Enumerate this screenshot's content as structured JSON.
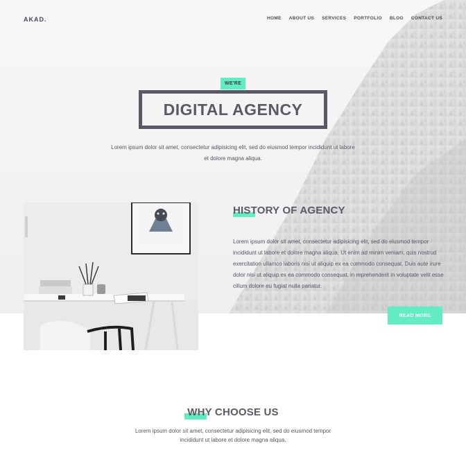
{
  "header": {
    "logo": "AKAD.",
    "nav": [
      "HOME",
      "ABOUT US",
      "SERVICES",
      "PORTFOLIO",
      "BLOG",
      "CONTACT US"
    ]
  },
  "hero": {
    "tag": "WE'RE",
    "title": "DIGITAL AGENCY",
    "text": "Lorem ipsum dolor sit amet, consectetur adipisicing elit, sed do eiusmod tempor incididunt ut labore et dolore magna aliqua."
  },
  "history": {
    "title": "HISTORY OF AGENCY",
    "text": "Lorem ipsum dolor sit amet, consectetur adipisicing elit, sed do eiusmod tempor incididunt ut labore et dolore magna aliqua. Ut enim ad minim veniam, quis nostrud exercitation ullamco laboris nisi ut aliquip ex ea commodo consequat. Duis aute irure dolor nisi ut aliquip ex ea commodo consequat. in reprehenderit in voluptate velit esse cillum dolore eu fugiat nulla pariatur.",
    "button": "READ MORE"
  },
  "why": {
    "title": "WHY CHOOSE US",
    "text": "Lorem ipsum dolor sit amet, consectetur adipisicing elit, sed do eiusmod tempor incididunt ut labore et dolore magna aliqua."
  },
  "colors": {
    "accent": "#63ecc2",
    "text_dark": "#5a5a66"
  }
}
